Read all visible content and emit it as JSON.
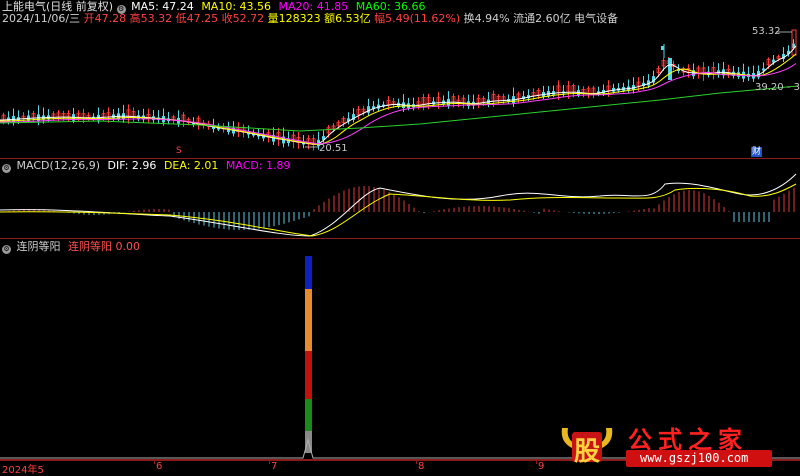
{
  "header": {
    "stock_name": "上能电气",
    "period": "(日线 前复权)",
    "ma5": "MA5: 47.24",
    "ma10": "MA10: 43.56",
    "ma20": "MA20: 41.85",
    "ma60": "MA60: 36.66",
    "colors": {
      "ma5": "#ffffff",
      "ma10": "#ffff00",
      "ma20": "#ff00ff",
      "ma60": "#00ff00"
    }
  },
  "quote": {
    "date": "2024/11/06/三",
    "open": "开47.28",
    "high": "高53.32",
    "low": "低47.25",
    "close": "收52.72",
    "volume": "量128323",
    "amount": "额6.53亿",
    "change": "幅5.49(11.62%)",
    "turnover": "换4.94%",
    "float_cap": "流通2.60亿",
    "sector": "电气设备"
  },
  "price_panel": {
    "high_label": "53.32",
    "low_label": "20.51",
    "right_label": "39.20 - 39",
    "cai_badge": "财",
    "marker_s": "S"
  },
  "macd": {
    "title": "MACD(12,26,9)",
    "dif": "DIF: 2.96",
    "dea": "DEA: 2.01",
    "macd_val": "MACD: 1.89"
  },
  "indicator": {
    "name": "连阴等阳",
    "label": "连阴等阳",
    "value": "0.00"
  },
  "xaxis": {
    "labels": [
      "2024年5",
      "6",
      "7",
      "8",
      "9"
    ]
  },
  "watermark": {
    "logo_char": "股",
    "name": "公式之家",
    "url": "www.gszj100.com"
  }
}
